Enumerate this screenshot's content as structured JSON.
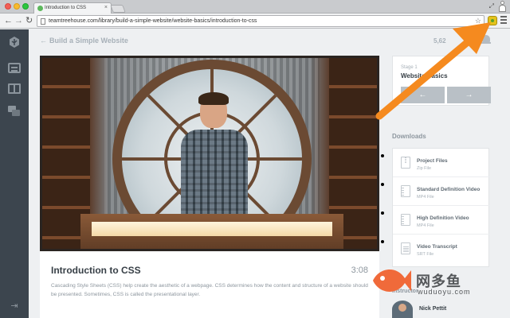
{
  "browser": {
    "tab_title": "Introduction to CSS",
    "tab_close": "×",
    "url": "teamtreehouse.com/library/build-a-simple-website/website-basics/introduction-to-css"
  },
  "page": {
    "back_link": "Build a Simple Website",
    "points": "5,62"
  },
  "video": {
    "title": "Introduction to CSS",
    "duration": "3:08",
    "description": "Cascading Style Sheets (CSS) help create the aesthetic of a webpage. CSS determines how the content and structure of a website should be presented. Sometimes, CSS is called the presentational layer."
  },
  "stage": {
    "label": "Stage 1",
    "title": "Website Basics",
    "prev_glyph": "←",
    "next_glyph": "→"
  },
  "downloads": {
    "heading": "Downloads",
    "items": [
      {
        "name": "Project Files",
        "type": "Zip File",
        "icon": "zip-file-icon"
      },
      {
        "name": "Standard Definition Video",
        "type": "MP4 File",
        "icon": "video-file-icon"
      },
      {
        "name": "High Definition Video",
        "type": "MP4 File",
        "icon": "video-file-icon"
      },
      {
        "name": "Video Transcript",
        "type": "SRT File",
        "icon": "document-file-icon"
      }
    ]
  },
  "instructor": {
    "label": "Instructor",
    "name": "Nick Pettit"
  },
  "watermark": {
    "chinese": "网多鱼",
    "url": "wuduoyu.com"
  },
  "colors": {
    "left_nav_bg": "#3c454e",
    "arrow_orange": "#f58a1f",
    "watermark_fish": "#f06a3a"
  }
}
